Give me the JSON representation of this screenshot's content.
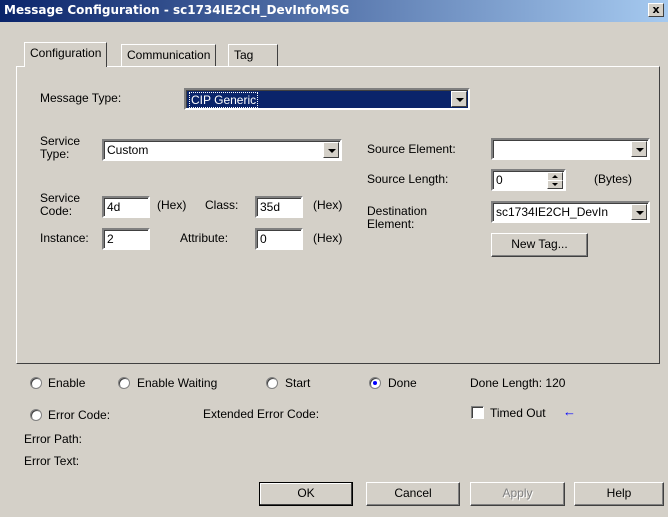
{
  "window": {
    "title": "Message Configuration - sc1734IE2CH_DevInfoMSG",
    "close_glyph": "x"
  },
  "tabs": [
    {
      "label": "Configuration",
      "active": true
    },
    {
      "label": "Communication",
      "active": false
    },
    {
      "label": "Tag",
      "active": false
    }
  ],
  "config": {
    "message_type_label": "Message Type:",
    "message_type_value": "CIP Generic",
    "service_type_label_1": "Service",
    "service_type_label_2": "Type:",
    "service_type_value": "Custom",
    "service_code_label_1": "Service",
    "service_code_label_2": "Code:",
    "service_code_value": "4d",
    "hex_label": "(Hex)",
    "class_label": "Class:",
    "class_value": "35d",
    "instance_label": "Instance:",
    "instance_value": "2",
    "attribute_label": "Attribute:",
    "attribute_value": "0",
    "source_element_label": "Source Element:",
    "source_element_value": "",
    "source_length_label": "Source Length:",
    "source_length_value": "0",
    "bytes_label": "(Bytes)",
    "destination_label_1": "Destination",
    "destination_label_2": "Element:",
    "destination_value": "sc1734IE2CH_DevIn",
    "new_tag_label": "New Tag..."
  },
  "status": {
    "enable": "Enable",
    "enable_waiting": "Enable Waiting",
    "start": "Start",
    "done": "Done",
    "done_length": "Done Length: 120",
    "error_code": "Error Code:",
    "extended_error_code": "Extended Error Code:",
    "timed_out": "Timed Out",
    "error_path": "Error Path:",
    "error_text": "Error Text:",
    "accent_color": "#0000ff"
  },
  "buttons": {
    "ok": "OK",
    "cancel": "Cancel",
    "apply": "Apply",
    "help": "Help"
  }
}
